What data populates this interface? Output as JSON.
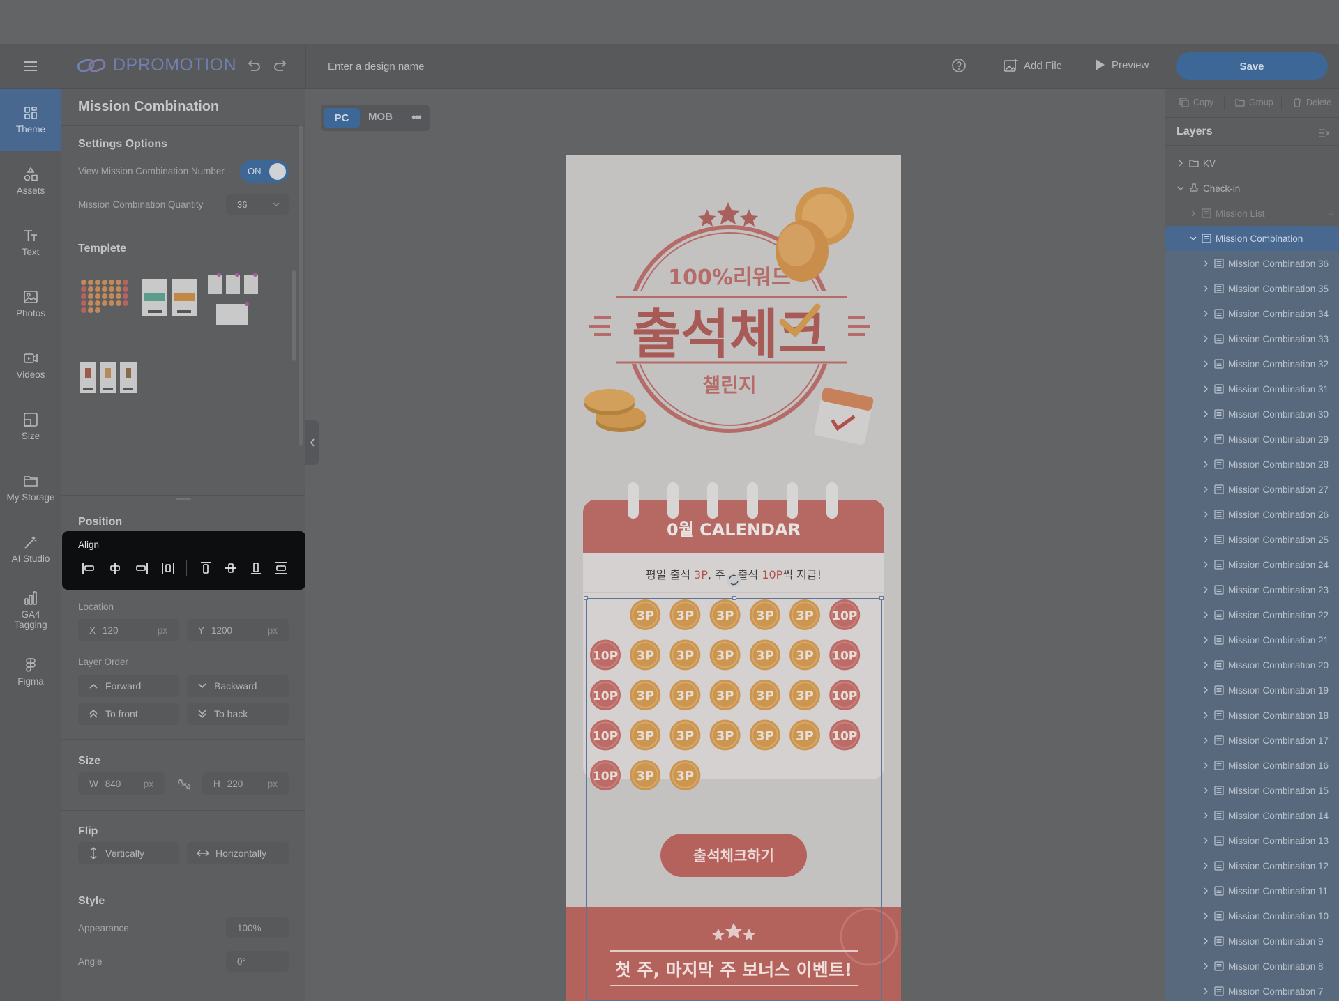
{
  "header": {
    "brand": "DPROMOTION",
    "design_name_placeholder": "Enter a design name",
    "add_file": "Add File",
    "preview": "Preview",
    "save": "Save"
  },
  "rail": {
    "items": [
      {
        "label": "Theme",
        "icon": "theme-icon"
      },
      {
        "label": "Assets",
        "icon": "assets-icon"
      },
      {
        "label": "Text",
        "icon": "text-icon"
      },
      {
        "label": "Photos",
        "icon": "photos-icon"
      },
      {
        "label": "Videos",
        "icon": "videos-icon"
      },
      {
        "label": "Size",
        "icon": "size-icon"
      },
      {
        "label": "My Storage",
        "icon": "folder-icon"
      },
      {
        "label": "AI Studio",
        "icon": "magic-wand-icon"
      },
      {
        "label": "GA4\nTagging",
        "icon": "bar-chart-icon"
      },
      {
        "label": "Figma",
        "icon": "figma-icon"
      }
    ]
  },
  "panel": {
    "title": "Mission Combination",
    "settings_title": "Settings Options",
    "view_number_label": "View Mission Combination Number",
    "toggle_state": "ON",
    "quantity_label": "Mission Combination Quantity",
    "quantity_value": "36",
    "template_title": "Templete",
    "position_title": "Position",
    "align_title": "Align",
    "location_label": "Location",
    "x_label": "X",
    "x_value": "120",
    "x_unit": "px",
    "y_label": "Y",
    "y_value": "1200",
    "y_unit": "px",
    "layer_order_label": "Layer Order",
    "forward": "Forward",
    "backward": "Backward",
    "to_front": "To front",
    "to_back": "To back",
    "size_title": "Size",
    "w_label": "W",
    "w_value": "840",
    "w_unit": "px",
    "h_label": "H",
    "h_value": "220",
    "h_unit": "px",
    "flip_title": "Flip",
    "vertically": "Vertically",
    "horizontally": "Horizontally",
    "style_title": "Style",
    "appearance_label": "Appearance",
    "appearance_value": "100%",
    "angle_label": "Angle",
    "angle_value": "0°"
  },
  "canvas": {
    "device_pc": "PC",
    "device_mob": "MOB",
    "reward_text": "100%리워드",
    "title_text": "출석체크",
    "subtitle_text": "챌린지",
    "calendar_header": "0월 CALENDAR",
    "notice_parts": [
      "평일 출석 ",
      "3P",
      ", 주",
      "출석 ",
      "10P",
      "씩 지급!"
    ],
    "coins": [
      [
        "",
        "3P",
        "3P",
        "3P",
        "3P",
        "3P",
        "10P"
      ],
      [
        "10P",
        "3P",
        "3P",
        "3P",
        "3P",
        "3P",
        "10P"
      ],
      [
        "10P",
        "3P",
        "3P",
        "3P",
        "3P",
        "3P",
        "10P"
      ],
      [
        "10P",
        "3P",
        "3P",
        "3P",
        "3P",
        "3P",
        "10P"
      ],
      [
        "10P",
        "3P",
        "3P"
      ]
    ],
    "cta": "출석체크하기",
    "bonus_title": "첫 주, 마지막 주 보너스 이벤트!",
    "colors": {
      "accent": "#3d6796",
      "coral": "#bd6b66",
      "gold": "#cc9651"
    }
  },
  "right_panel": {
    "copy": "Copy",
    "group": "Group",
    "delete": "Delete",
    "layers_title": "Layers",
    "layers": [
      {
        "name": "KV",
        "level": 0,
        "state": "normal",
        "icon": "folder-icon",
        "chevron": "right"
      },
      {
        "name": "Check-in",
        "level": 0,
        "state": "normal",
        "icon": "stamp-icon",
        "chevron": "down"
      },
      {
        "name": "Mission List",
        "level": 1,
        "state": "dim",
        "icon": "list-icon",
        "chevron": "right"
      },
      {
        "name": "Mission Combination",
        "level": 1,
        "state": "selected",
        "icon": "list-icon",
        "chevron": "down"
      },
      {
        "name": "Mission Combination 36",
        "level": 2,
        "state": "child"
      },
      {
        "name": "Mission Combination 35",
        "level": 2,
        "state": "child"
      },
      {
        "name": "Mission Combination 34",
        "level": 2,
        "state": "child"
      },
      {
        "name": "Mission Combination 33",
        "level": 2,
        "state": "child"
      },
      {
        "name": "Mission Combination 32",
        "level": 2,
        "state": "child"
      },
      {
        "name": "Mission Combination 31",
        "level": 2,
        "state": "child"
      },
      {
        "name": "Mission Combination 30",
        "level": 2,
        "state": "child"
      },
      {
        "name": "Mission Combination 29",
        "level": 2,
        "state": "child"
      },
      {
        "name": "Mission Combination 28",
        "level": 2,
        "state": "child"
      },
      {
        "name": "Mission Combination 27",
        "level": 2,
        "state": "child"
      },
      {
        "name": "Mission Combination 26",
        "level": 2,
        "state": "child"
      },
      {
        "name": "Mission Combination 25",
        "level": 2,
        "state": "child"
      },
      {
        "name": "Mission Combination 24",
        "level": 2,
        "state": "child"
      },
      {
        "name": "Mission Combination 23",
        "level": 2,
        "state": "child"
      },
      {
        "name": "Mission Combination 22",
        "level": 2,
        "state": "child"
      },
      {
        "name": "Mission Combination 21",
        "level": 2,
        "state": "child"
      },
      {
        "name": "Mission Combination 20",
        "level": 2,
        "state": "child"
      },
      {
        "name": "Mission Combination 19",
        "level": 2,
        "state": "child"
      },
      {
        "name": "Mission Combination 18",
        "level": 2,
        "state": "child"
      },
      {
        "name": "Mission Combination 17",
        "level": 2,
        "state": "child"
      },
      {
        "name": "Mission Combination 16",
        "level": 2,
        "state": "child"
      },
      {
        "name": "Mission Combination 15",
        "level": 2,
        "state": "child"
      },
      {
        "name": "Mission Combination 14",
        "level": 2,
        "state": "child"
      },
      {
        "name": "Mission Combination 13",
        "level": 2,
        "state": "child"
      },
      {
        "name": "Mission Combination 12",
        "level": 2,
        "state": "child"
      },
      {
        "name": "Mission Combination 11",
        "level": 2,
        "state": "child"
      },
      {
        "name": "Mission Combination 10",
        "level": 2,
        "state": "child"
      },
      {
        "name": "Mission Combination 9",
        "level": 2,
        "state": "child"
      },
      {
        "name": "Mission Combination 8",
        "level": 2,
        "state": "child"
      },
      {
        "name": "Mission Combination 7",
        "level": 2,
        "state": "child"
      }
    ]
  }
}
